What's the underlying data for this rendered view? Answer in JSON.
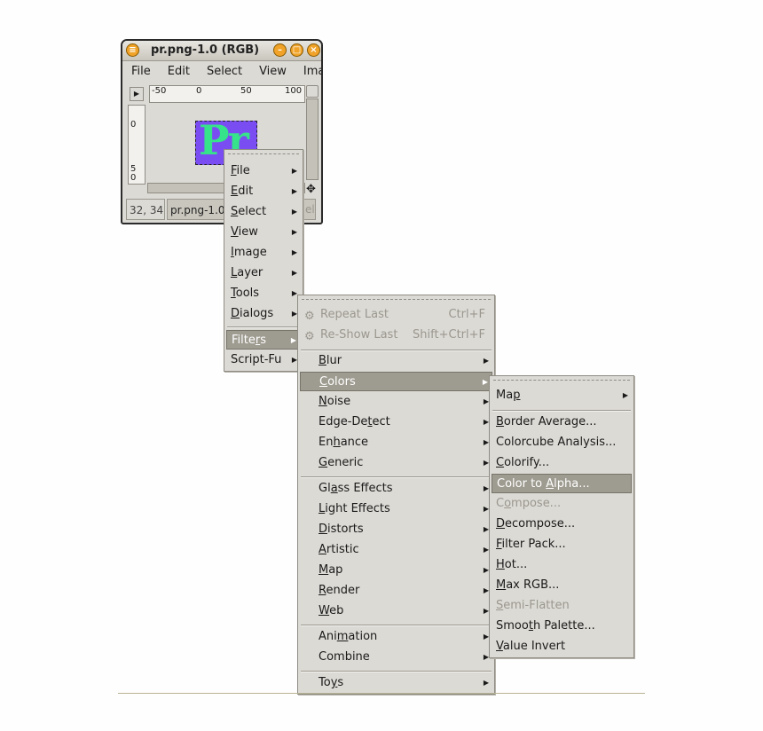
{
  "window": {
    "title": "pr.png-1.0 (RGB)",
    "menubar": [
      "File",
      "Edit",
      "Select",
      "View",
      "Ima"
    ],
    "ruler_h": [
      "-50",
      "0",
      "50",
      "100"
    ],
    "ruler_v": [
      "0",
      "5",
      "0"
    ],
    "image_text": "Pr",
    "status_coords": "32, 34",
    "status_file": "pr.png-1.0",
    "status_cancel": "el"
  },
  "context_menu": {
    "items": [
      {
        "label": "File",
        "u": "F"
      },
      {
        "label": "Edit",
        "u": "E"
      },
      {
        "label": "Select",
        "u": "S"
      },
      {
        "label": "View",
        "u": "V"
      },
      {
        "label": "Image",
        "u": "I"
      },
      {
        "label": "Layer",
        "u": "L"
      },
      {
        "label": "Tools",
        "u": "T"
      },
      {
        "label": "Dialogs",
        "u": "D"
      },
      {
        "label": "Filters",
        "u": "r"
      },
      {
        "label": "Script-Fu",
        "u": ""
      }
    ]
  },
  "filters_menu": {
    "repeat_last": {
      "label": "Repeat Last",
      "shortcut": "Ctrl+F"
    },
    "reshow_last": {
      "label": "Re-Show Last",
      "shortcut": "Shift+Ctrl+F"
    },
    "group1": [
      "Blur",
      "Colors",
      "Noise",
      "Edge-Detect",
      "Enhance",
      "Generic"
    ],
    "group2": [
      "Glass Effects",
      "Light Effects",
      "Distorts",
      "Artistic",
      "Map",
      "Render",
      "Web"
    ],
    "group3": [
      "Animation",
      "Combine"
    ],
    "group4": [
      "Toys"
    ]
  },
  "colors_menu": {
    "map": "Map",
    "items": [
      "Border Average...",
      "Colorcube Analysis...",
      "Colorify...",
      "Color to Alpha...",
      "Compose...",
      "Decompose...",
      "Filter Pack...",
      "Hot...",
      "Max RGB...",
      "Semi-Flatten",
      "Smooth Palette...",
      "Value Invert"
    ]
  },
  "colors": {
    "menu_bg": "#dcdad5",
    "selected_bg": "#9e9b90",
    "image_purple": "#7a4df3",
    "image_green": "#36e38a",
    "title_button": "#f0a328"
  }
}
